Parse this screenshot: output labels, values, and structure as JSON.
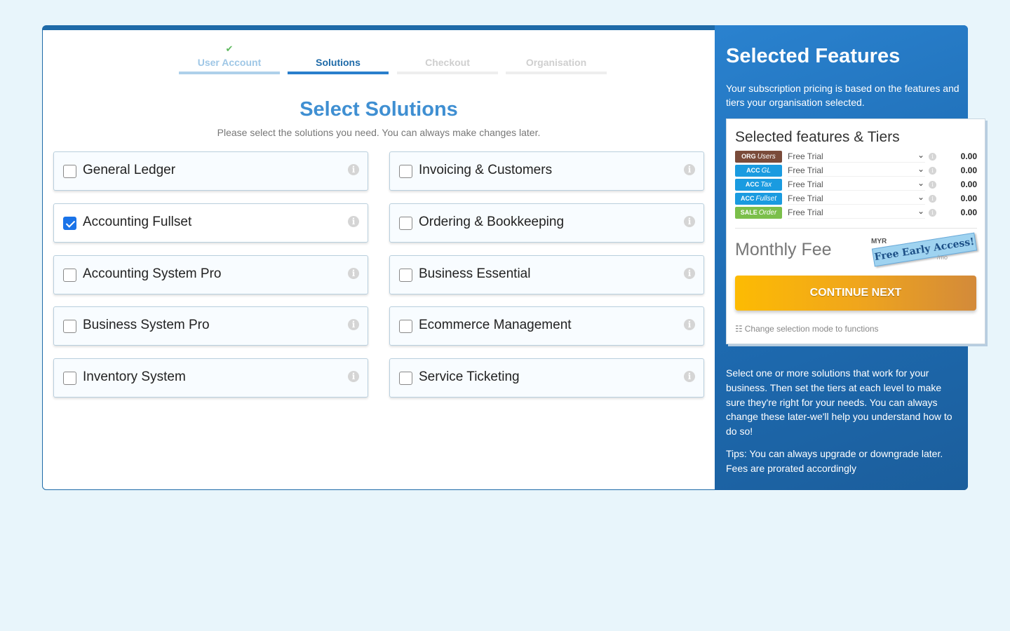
{
  "steps": [
    {
      "label": "User Account",
      "state": "done",
      "check": "✔"
    },
    {
      "label": "Solutions",
      "state": "active"
    },
    {
      "label": "Checkout",
      "state": "future"
    },
    {
      "label": "Organisation",
      "state": "future"
    }
  ],
  "main": {
    "title": "Select Solutions",
    "subtitle": "Please select the solutions you need. You can always make changes later.",
    "options": [
      {
        "label": "General Ledger",
        "checked": false
      },
      {
        "label": "Invoicing & Customers",
        "checked": false
      },
      {
        "label": "Accounting Fullset",
        "checked": true
      },
      {
        "label": "Ordering & Bookkeeping",
        "checked": false
      },
      {
        "label": "Accounting System Pro",
        "checked": false
      },
      {
        "label": "Business Essential",
        "checked": false
      },
      {
        "label": "Business System Pro",
        "checked": false
      },
      {
        "label": "Ecommerce Management",
        "checked": false
      },
      {
        "label": "Inventory System",
        "checked": false
      },
      {
        "label": "Service Ticketing",
        "checked": false
      }
    ],
    "info_glyph": "i"
  },
  "sidebar": {
    "title": "Selected Features",
    "description": "Your subscription pricing is based on the features and tiers your organisation selected.",
    "box_title": "Selected features & Tiers",
    "features": [
      {
        "prefix": "ORG",
        "name": "Users",
        "tier": "Free Trial",
        "amount": "0.00",
        "color": "#7a4b3a"
      },
      {
        "prefix": "ACC",
        "name": "GL",
        "tier": "Free Trial",
        "amount": "0.00",
        "color": "#1a9be0"
      },
      {
        "prefix": "ACC",
        "name": "Tax",
        "tier": "Free Trial",
        "amount": "0.00",
        "color": "#1a9be0"
      },
      {
        "prefix": "ACC",
        "name": "Fullset",
        "tier": "Free Trial",
        "amount": "0.00",
        "color": "#1a9be0"
      },
      {
        "prefix": "SALE",
        "name": "Order",
        "tier": "Free Trial",
        "amount": "0.00",
        "color": "#7bbf4a"
      }
    ],
    "monthly_fee_label": "Monthly Fee",
    "currency": "MYR",
    "stamp": "Free Early Access!",
    "per_month": "/mo",
    "cta": "CONTINUE NEXT",
    "mode_link": "Change selection mode to functions",
    "help": "Select one or more solutions that work for your business. Then set the tiers at each level to make sure they're right for your needs. You can always change these later-we'll help you understand how to do so!",
    "tips": "Tips: You can always upgrade or downgrade later. Fees are prorated accordingly"
  },
  "colors": {
    "accent": "#1e6aa8",
    "title_blue": "#3f8fd2",
    "cta_start": "#fdbb03",
    "cta_end": "#d38a3a"
  }
}
